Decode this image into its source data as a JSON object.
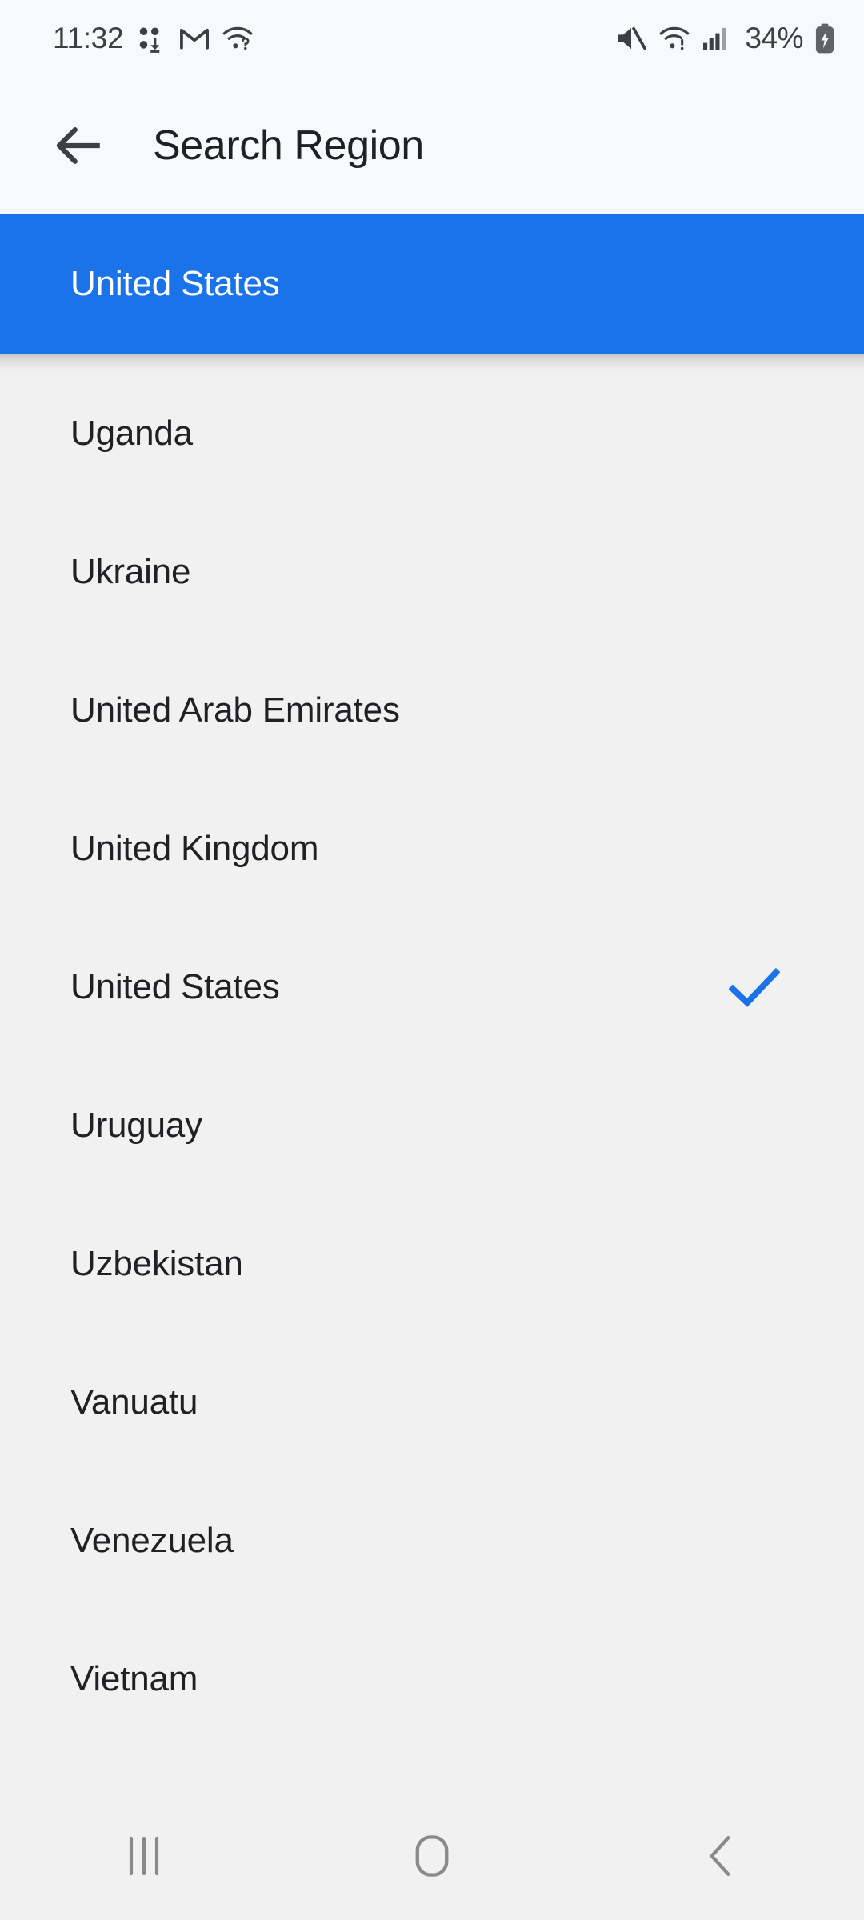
{
  "status_bar": {
    "time": "11:32",
    "battery_percent": "34%",
    "left_icons": [
      {
        "name": "dots-download-icon"
      },
      {
        "name": "gmail-m-icon"
      },
      {
        "name": "wifi-question-icon"
      }
    ],
    "right_icons": [
      {
        "name": "volume-muted-icon"
      },
      {
        "name": "wifi-alert-icon"
      },
      {
        "name": "cellular-signal-icon"
      },
      {
        "name": "battery-charging-icon"
      }
    ]
  },
  "app_bar": {
    "title": "Search Region",
    "back_label": "Back"
  },
  "selected_band": {
    "label": "United States"
  },
  "colors": {
    "accent": "#1a73e8",
    "band_background": "#1a73e8",
    "band_text": "#ffffff",
    "list_background": "#f1f1f1",
    "appbar_background": "#f8f9fd",
    "text_primary": "#202124",
    "status_text": "#3c4043",
    "nav_icon": "#8a8a8a",
    "check": "#1a73e8"
  },
  "regions": [
    {
      "label": "Uganda",
      "selected": false
    },
    {
      "label": "Ukraine",
      "selected": false
    },
    {
      "label": "United Arab Emirates",
      "selected": false
    },
    {
      "label": "United Kingdom",
      "selected": false
    },
    {
      "label": "United States",
      "selected": true
    },
    {
      "label": "Uruguay",
      "selected": false
    },
    {
      "label": "Uzbekistan",
      "selected": false
    },
    {
      "label": "Vanuatu",
      "selected": false
    },
    {
      "label": "Venezuela",
      "selected": false
    },
    {
      "label": "Vietnam",
      "selected": false
    }
  ],
  "nav_bar": {
    "recents_label": "Recents",
    "home_label": "Home",
    "back_label": "Back"
  }
}
